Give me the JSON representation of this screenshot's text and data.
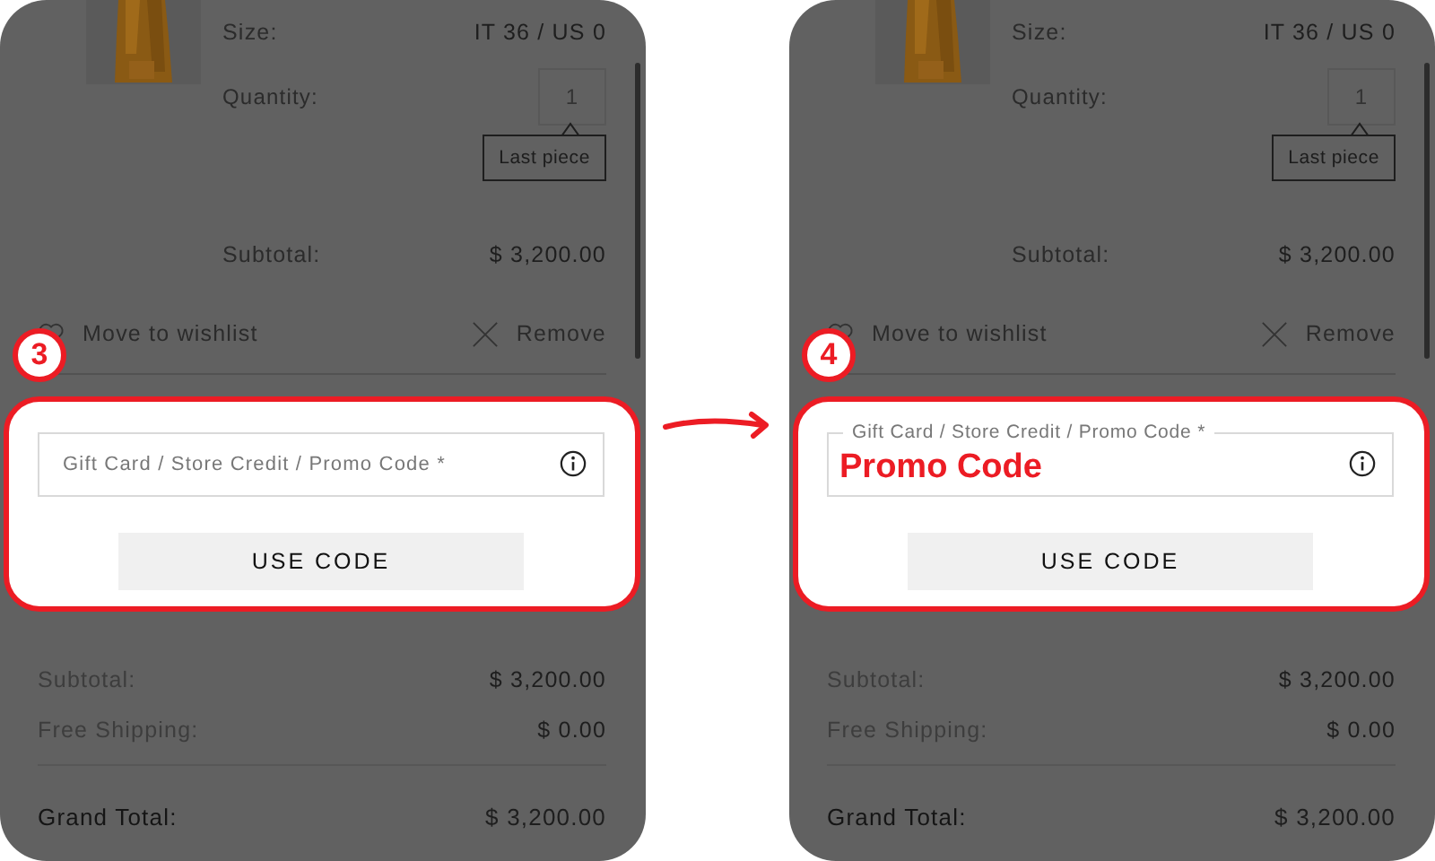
{
  "steps": [
    {
      "badge": "3",
      "item": {
        "size_label": "Size:",
        "size": "IT 36 / US 0",
        "quantity_label": "Quantity:",
        "quantity": "1",
        "tooltip": "Last piece",
        "subtotal_label": "Subtotal:",
        "subtotal": "$ 3,200.00",
        "wishlist": "Move to wishlist",
        "remove": "Remove"
      },
      "promo": {
        "placeholder": "Gift Card / Store Credit / Promo Code *",
        "button": "USE CODE"
      },
      "summary": [
        {
          "label": "Subtotal:",
          "value": "$ 3,200.00"
        },
        {
          "label": "Free Shipping:",
          "value": "$ 0.00"
        }
      ],
      "total": {
        "label": "Grand Total:",
        "value": "$ 3,200.00"
      }
    },
    {
      "badge": "4",
      "item": {
        "size_label": "Size:",
        "size": "IT 36 / US 0",
        "quantity_label": "Quantity:",
        "quantity": "1",
        "tooltip": "Last piece",
        "subtotal_label": "Subtotal:",
        "subtotal": "$ 3,200.00",
        "wishlist": "Move to wishlist",
        "remove": "Remove"
      },
      "promo": {
        "label": "Gift Card / Store Credit / Promo Code *",
        "value": "Promo Code",
        "button": "USE CODE"
      },
      "summary": [
        {
          "label": "Subtotal:",
          "value": "$ 3,200.00"
        },
        {
          "label": "Free Shipping:",
          "value": "$ 0.00"
        }
      ],
      "total": {
        "label": "Grand Total:",
        "value": "$ 3,200.00"
      }
    }
  ]
}
